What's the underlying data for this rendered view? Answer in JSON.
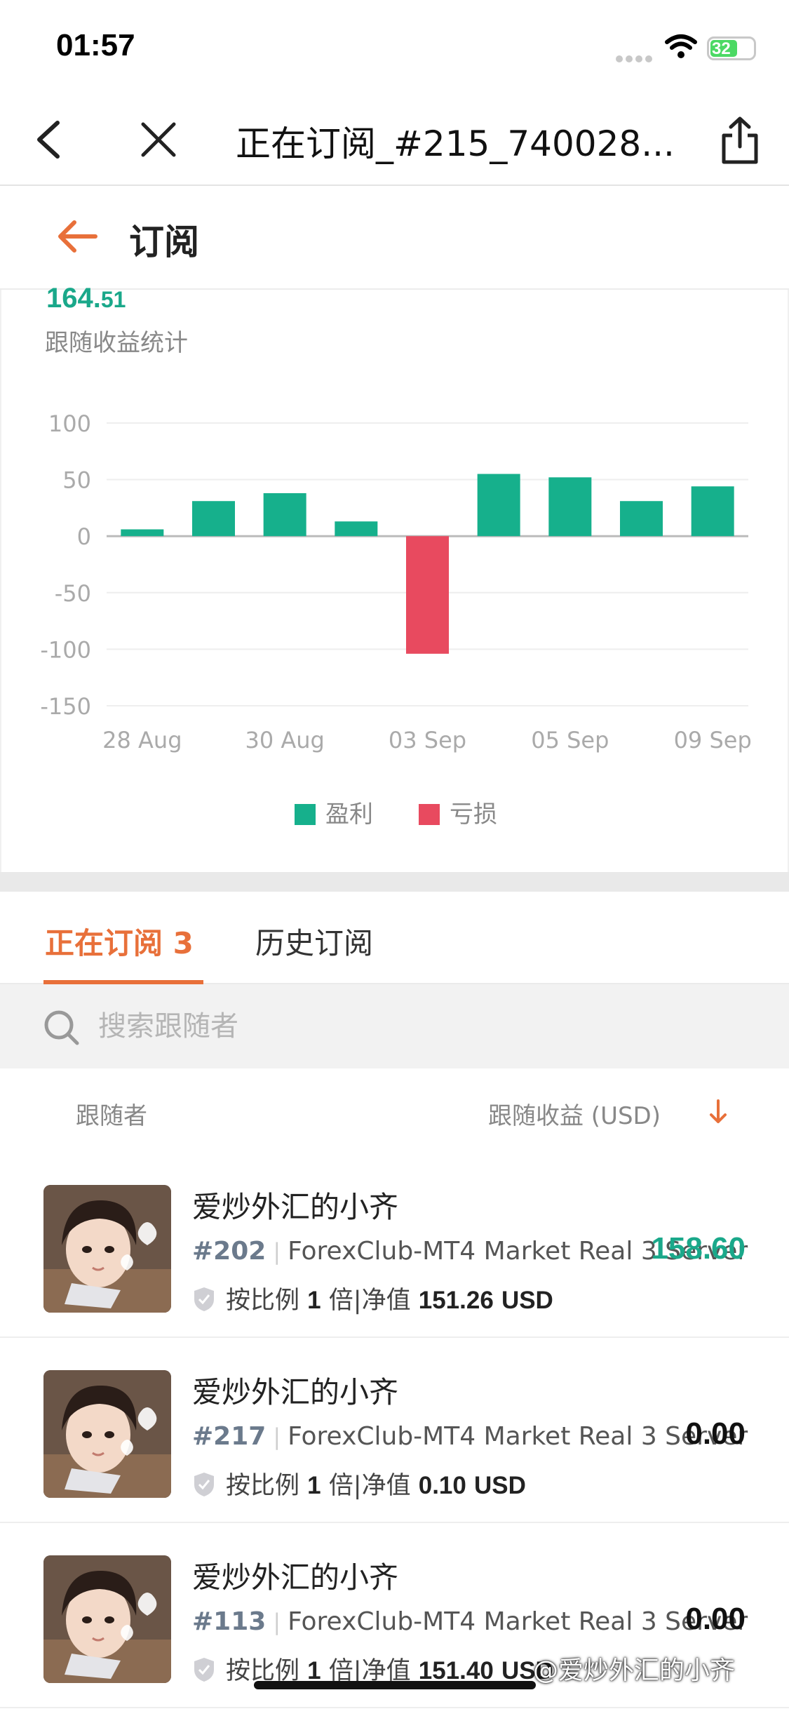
{
  "status_bar": {
    "time": "01:57",
    "battery": "32"
  },
  "browser": {
    "title": "正在订阅_#215_740028..."
  },
  "header": {
    "title": "订阅"
  },
  "summary": {
    "amount_int": "164.",
    "amount_dec": "51",
    "label": "跟随收益统计"
  },
  "colors": {
    "profit": "#16b08c",
    "loss": "#e84a5f",
    "accent": "#e8703a"
  },
  "chart_data": {
    "type": "bar",
    "x": [
      "28 Aug",
      "29 Aug",
      "30 Aug",
      "31 Aug",
      "03 Sep",
      "04 Sep",
      "05 Sep",
      "06 Sep",
      "09 Sep"
    ],
    "xtick_labels": [
      "28 Aug",
      "30 Aug",
      "03 Sep",
      "05 Sep",
      "09 Sep"
    ],
    "series": [
      {
        "name": "盈利",
        "values": [
          6,
          31,
          38,
          13,
          null,
          55,
          52,
          31,
          44
        ]
      },
      {
        "name": "亏损",
        "values": [
          null,
          null,
          null,
          null,
          -104,
          null,
          null,
          null,
          null
        ]
      }
    ],
    "yticks": [
      100,
      50,
      0,
      -50,
      -100,
      -150
    ],
    "ylim": [
      -150,
      100
    ],
    "legend": [
      {
        "label": "盈利",
        "color": "#16b08c"
      },
      {
        "label": "亏损",
        "color": "#e84a5f"
      }
    ],
    "legend_position": "bottom-center",
    "grid": true
  },
  "tabs": [
    {
      "label": "正在订阅 3",
      "active": true
    },
    {
      "label": "历史订阅",
      "active": false
    }
  ],
  "search": {
    "placeholder": "搜索跟随者"
  },
  "columns": {
    "follower": "跟随者",
    "profit": "跟随收益 (USD)"
  },
  "followers": [
    {
      "name": "爱炒外汇的小齐",
      "account": "#202",
      "server": "ForexClub-MT4 Market Real 3 Server",
      "mode": "按比例",
      "mult": "1",
      "mult_unit": "倍",
      "equity_label": "净值",
      "equity": "151.26",
      "currency": "USD",
      "profit": "158.60"
    },
    {
      "name": "爱炒外汇的小齐",
      "account": "#217",
      "server": "ForexClub-MT4 Market Real 3 Server",
      "mode": "按比例",
      "mult": "1",
      "mult_unit": "倍",
      "equity_label": "净值",
      "equity": "0.10",
      "currency": "USD",
      "profit": "0.00"
    },
    {
      "name": "爱炒外汇的小齐",
      "account": "#113",
      "server": "ForexClub-MT4 Market Real 3 Server",
      "mode": "按比例",
      "mult": "1",
      "mult_unit": "倍",
      "equity_label": "净值",
      "equity": "151.40",
      "currency": "USD",
      "profit": "0.00"
    }
  ],
  "watermark": "@爱炒外汇的小齐"
}
